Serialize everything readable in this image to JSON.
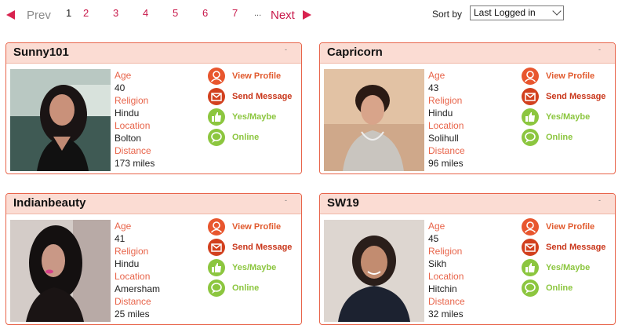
{
  "pagination": {
    "prev": "Prev",
    "pages": [
      "1",
      "2",
      "3",
      "4",
      "5",
      "6",
      "7"
    ],
    "current": "1",
    "ellipsis": "...",
    "next": "Next"
  },
  "sort": {
    "label": "Sort by",
    "selected": "Last Logged in"
  },
  "labels": {
    "age": "Age",
    "religion": "Religion",
    "location": "Location",
    "distance": "Distance",
    "view_profile": "View Profile",
    "send_message": "Send Message",
    "yes_maybe": "Yes/Maybe",
    "online": "Online",
    "corner": "-"
  },
  "profiles": [
    {
      "name": "Sunny101",
      "age": "40",
      "religion": "Hindu",
      "location": "Bolton",
      "distance": "173 miles"
    },
    {
      "name": "Capricorn",
      "age": "43",
      "religion": "Hindu",
      "location": "Solihull",
      "distance": "96 miles"
    },
    {
      "name": "Indianbeauty",
      "age": "41",
      "religion": "Hindu",
      "location": "Amersham",
      "distance": "25 miles"
    },
    {
      "name": "SW19",
      "age": "45",
      "religion": "Sikh",
      "location": "Hitchin",
      "distance": "32 miles"
    }
  ],
  "icons": {
    "profile": "profile-icon",
    "message": "message-icon",
    "yes": "thumbs-up-icon",
    "online": "chat-online-icon"
  },
  "colors": {
    "accent": "#e8644a",
    "pager": "#c8184a",
    "green": "#8cc63f"
  }
}
